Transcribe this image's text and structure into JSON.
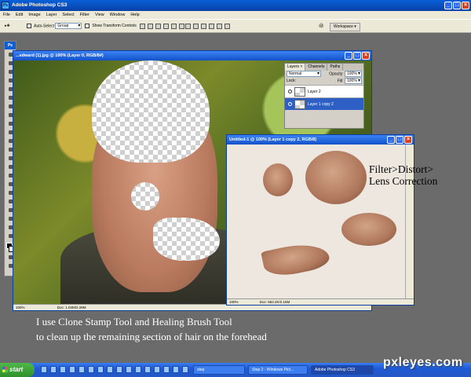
{
  "app": {
    "title": "Adobe Photoshop CS3",
    "logo": "Ps"
  },
  "menu": [
    "File",
    "Edit",
    "Image",
    "Layer",
    "Select",
    "Filter",
    "View",
    "Window",
    "Help"
  ],
  "options": {
    "auto_select_label": "Auto-Select",
    "auto_select_value": "Group",
    "show_transform_label": "Show Transform Controls",
    "workspace_label": "Workspace ▾"
  },
  "doc1": {
    "title": "...edward (1).jpg @ 100% (Layer 0, RGB/8#)",
    "zoom": "100%",
    "doc_info": "Doc: 1.03M/2.28M"
  },
  "doc2": {
    "title": "Untitled-1 @ 100% (Layer 1 copy 2, RGB/8)",
    "zoom": "100%",
    "doc_info": "Doc: 553.2K/2.16M"
  },
  "layers_panel": {
    "tabs": [
      "Layers ×",
      "Channels",
      "Paths"
    ],
    "blend_mode": "Normal",
    "opacity_label": "Opacity:",
    "opacity_value": "100%",
    "lock_label": "Lock:",
    "fill_label": "Fill:",
    "fill_value": "100%",
    "layers": [
      {
        "name": "Layer 2",
        "selected": false
      },
      {
        "name": "Layer 1 copy 2",
        "selected": true
      }
    ]
  },
  "annotations": {
    "filter_line1": "Filter>Distort>",
    "filter_line2": "Lens Correction",
    "bottom_line1": "I use Clone Stamp Tool and Healing Brush Tool",
    "bottom_line2": "to clean up the remaining section of hair on the forehead"
  },
  "taskbar": {
    "start_label": "start",
    "buttons": [
      "step",
      "Step 2 - Windows Pict...",
      "Adobe Photoshop CS3"
    ]
  },
  "watermark": "pxleyes.com"
}
